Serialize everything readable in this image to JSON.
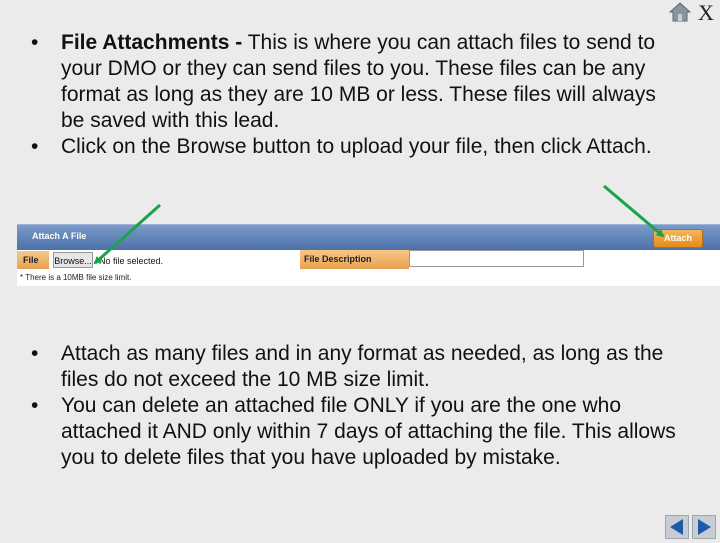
{
  "window": {
    "close_label": "X",
    "icons": {
      "home": "home-icon",
      "prev": "triangle-left-icon",
      "next": "triangle-right-icon"
    }
  },
  "top_bullets": [
    {
      "bold": "File Attachments -",
      "text": " This is where you can attach files to send to your DMO or they can send files to you.  These files can be any format as long as they are 10 MB or less.  These files will always be saved with this lead."
    },
    {
      "text": "Click on the Browse button to upload your file, then click Attach."
    }
  ],
  "attach_widget": {
    "title": "Attach A File",
    "attach_button": "Attach",
    "file_label": "File",
    "browse_button": "Browse...",
    "no_file_text": "No file selected.",
    "description_label": "File Description",
    "description_value": "",
    "size_note": "* There is a 10MB file size limit."
  },
  "bottom_bullets": [
    {
      "text": "Attach as many files and in any format as needed, as long as the files do not exceed the 10 MB size limit."
    },
    {
      "text": "You can delete an attached file ONLY if you are the one who attached it AND only within 7 days of attaching the file.  This allows you to delete files that you have uploaded by mistake."
    }
  ],
  "colors": {
    "background": "#ebebeb",
    "header_blue": "#5b7fb5",
    "button_orange": "#e8931f",
    "arrow_green": "#1aa34a"
  }
}
